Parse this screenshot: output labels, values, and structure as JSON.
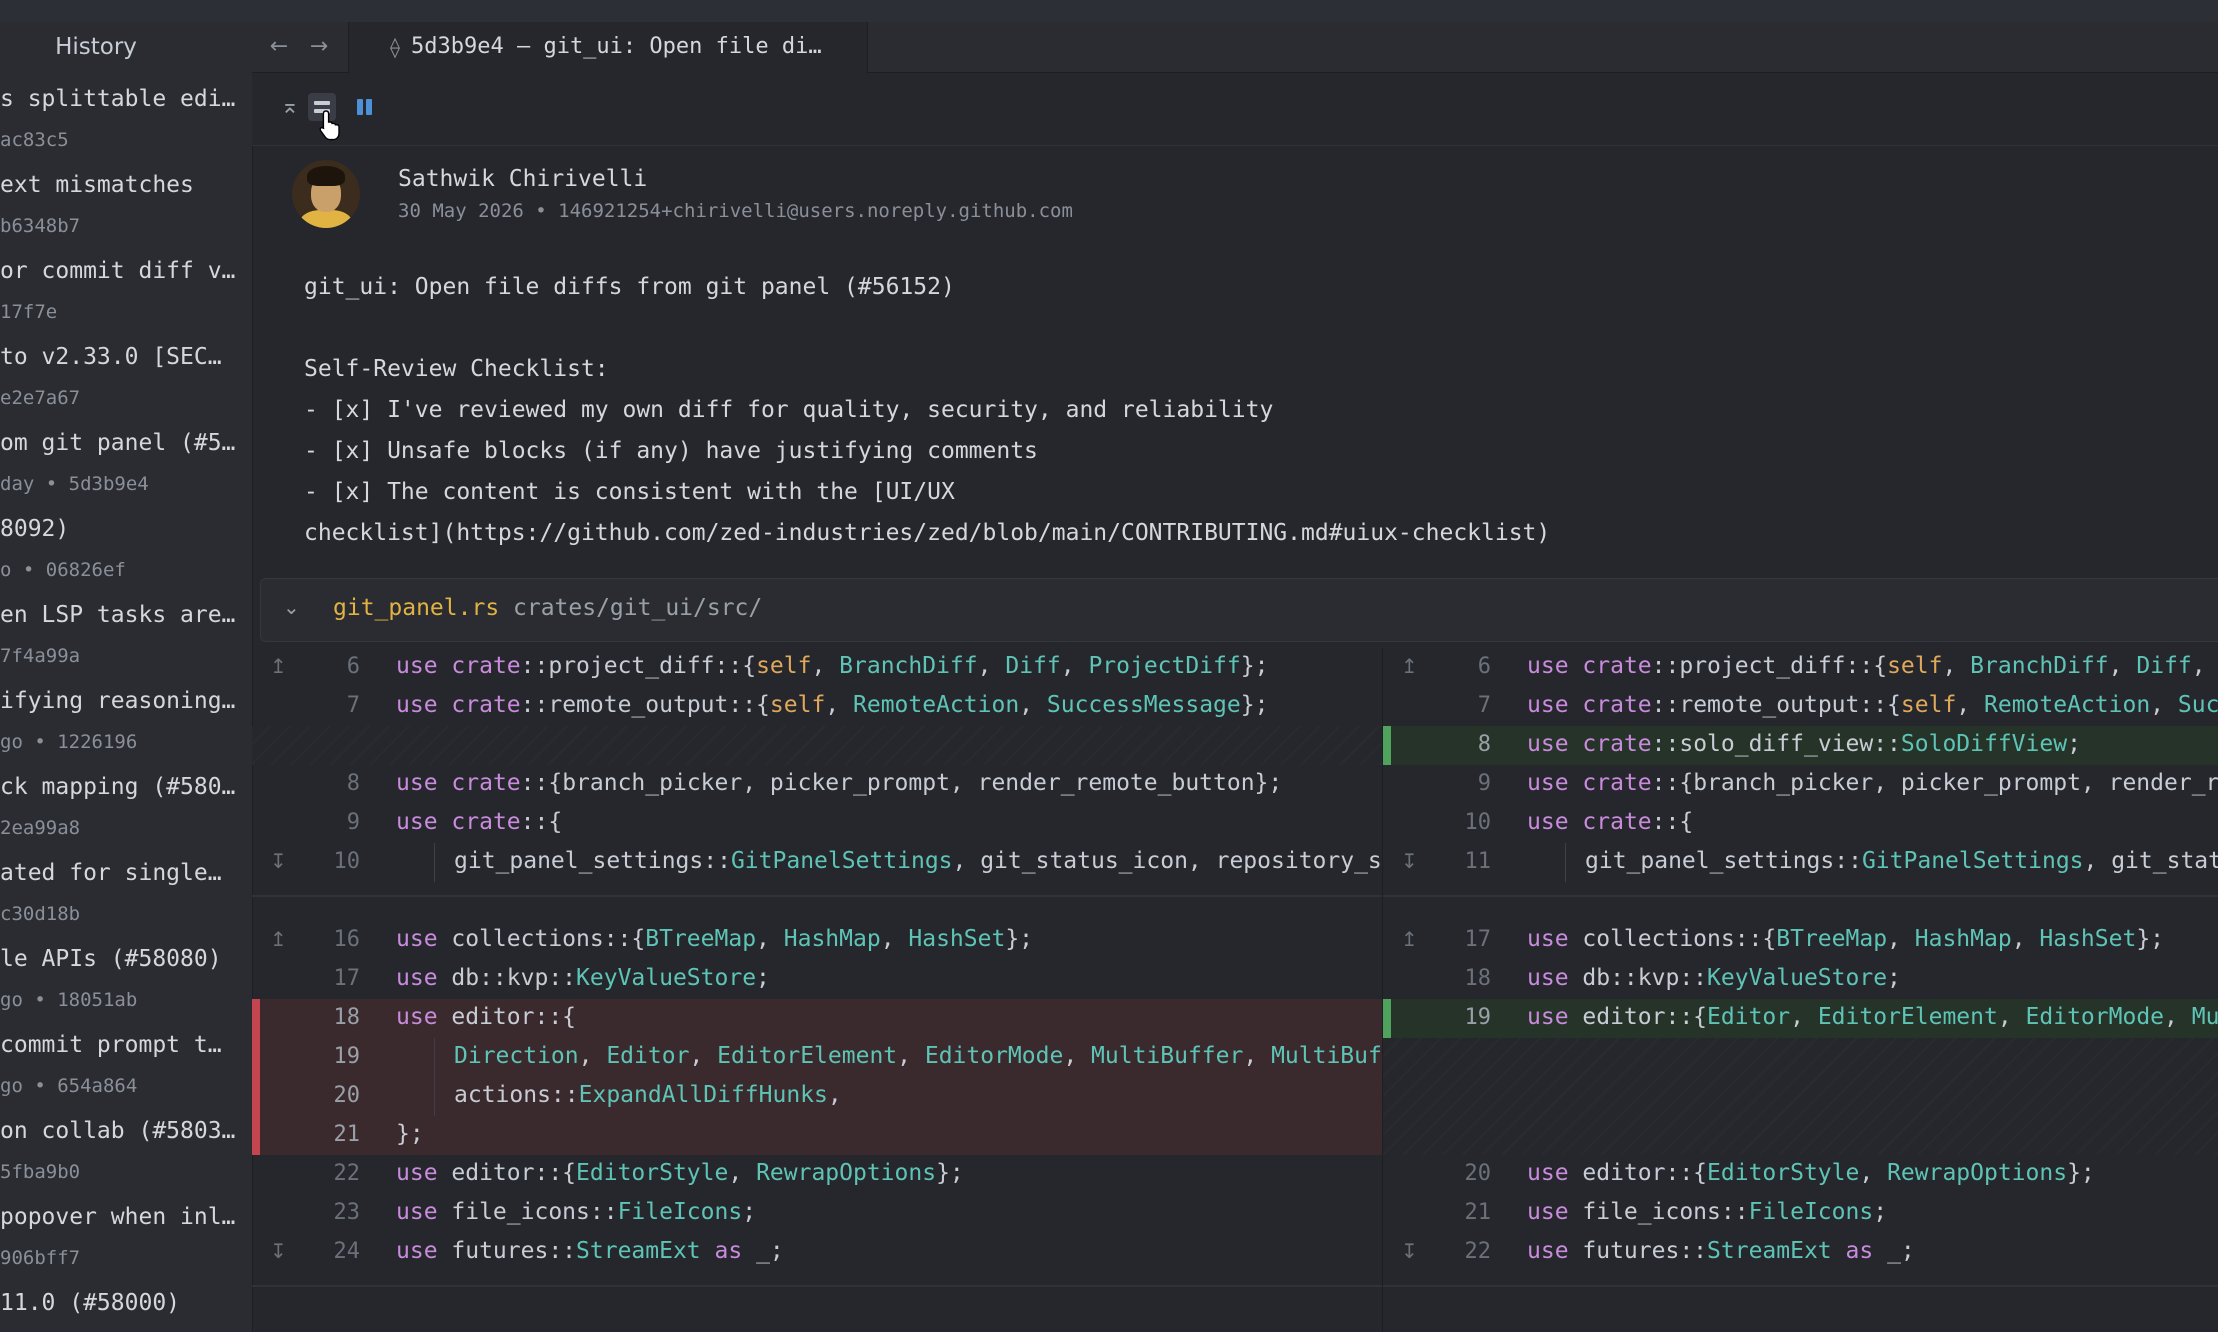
{
  "history": {
    "title": "History",
    "items": [
      {
        "subject": "s splittable edi…",
        "meta": "ac83c5"
      },
      {
        "subject": "ext mismatches",
        "meta": "b6348b7"
      },
      {
        "subject": "or commit diff v…",
        "meta": "17f7e"
      },
      {
        "subject": " to v2.33.0 [SEC…",
        "meta": " e2e7a67"
      },
      {
        "subject": "om git panel (#5…",
        "meta": "day • 5d3b9e4"
      },
      {
        "subject": "8092)",
        "meta": "o • 06826ef"
      },
      {
        "subject": "en LSP tasks are…",
        "meta": "7f4a99a"
      },
      {
        "subject": "ifying reasoning…",
        "meta": "go • 1226196"
      },
      {
        "subject": "ck mapping (#580…",
        "meta": " 2ea99a8"
      },
      {
        "subject": "ated for single…",
        "meta": "c30d18b"
      },
      {
        "subject": "le APIs (#58080)",
        "meta": "go • 18051ab"
      },
      {
        "subject": " commit prompt t…",
        "meta": "go • 654a864"
      },
      {
        "subject": "on collab (#5803…",
        "meta": " 5fba9b0"
      },
      {
        "subject": "popover when inl…",
        "meta": " 906bff7"
      },
      {
        "subject": "11.0 (#58000)",
        "meta": ""
      }
    ]
  },
  "tab": {
    "label": "5d3b9e4 — git_ui: Open file di…"
  },
  "commit": {
    "author": "Sathwik Chirivelli",
    "meta": "30 May 2026 • 146921254+chirivelli@users.noreply.github.com",
    "message": [
      "git_ui: Open file diffs from git panel (#56152)",
      "",
      "Self-Review Checklist:",
      "- [x] I've reviewed my own diff for quality, security, and reliability",
      "- [x] Unsafe blocks (if any) have justifying comments",
      "- [x] The content is consistent with the [UI/UX",
      "checklist](https://github.com/zed-industries/zed/blob/main/CONTRIBUTING.md#uiux-checklist)"
    ]
  },
  "file": {
    "name": "git_panel.rs",
    "path": "crates/git_ui/src/"
  },
  "colors": {
    "keyword": "#c98bdc",
    "type": "#5ec4b6",
    "self": "#e0a85a",
    "deleted_bar": "#c2454f",
    "added_bar": "#4fa35c"
  },
  "diff": {
    "left": [
      {
        "n": "6",
        "code": "use crate::project_diff::{self, BranchDiff, Diff, ProjectDiff};"
      },
      {
        "n": "7",
        "code": "use crate::remote_output::{self, RemoteAction, SuccessMessage};"
      },
      {
        "n": "8",
        "code": "use crate::{branch_picker, picker_prompt, render_remote_button};"
      },
      {
        "n": "9",
        "code": "use crate::{"
      },
      {
        "n": "10",
        "code": "git_panel_settings::GitPanelSettings, git_status_icon, repository_selector::RepositorySelector,"
      },
      {
        "n": "16",
        "code": "use collections::{BTreeMap, HashMap, HashSet};"
      },
      {
        "n": "17",
        "code": "use db::kvp::KeyValueStore;"
      },
      {
        "n": "18",
        "code": "use editor::{"
      },
      {
        "n": "19",
        "code": "Direction, Editor, EditorElement, EditorMode, MultiBuffer, MultiBufferOffset,"
      },
      {
        "n": "20",
        "code": "actions::ExpandAllDiffHunks,"
      },
      {
        "n": "21",
        "code": "};"
      },
      {
        "n": "22",
        "code": "use editor::{EditorStyle, RewrapOptions};"
      },
      {
        "n": "23",
        "code": "use file_icons::FileIcons;"
      },
      {
        "n": "24",
        "code": "use futures::StreamExt as _;"
      }
    ],
    "right": [
      {
        "n": "6",
        "code": "use crate::project_diff::{self, BranchDiff, Diff, ProjectDiff};"
      },
      {
        "n": "7",
        "code": "use crate::remote_output::{self, RemoteAction, SuccessMessage};"
      },
      {
        "n": "8",
        "code": "use crate::solo_diff_view::SoloDiffView;"
      },
      {
        "n": "9",
        "code": "use crate::{branch_picker, picker_prompt, render_remote_button};"
      },
      {
        "n": "10",
        "code": "use crate::{"
      },
      {
        "n": "11",
        "code": "git_panel_settings::GitPanelSettings, git_status_icon, repository_selector::RepositorySelector,"
      },
      {
        "n": "17",
        "code": "use collections::{BTreeMap, HashMap, HashSet};"
      },
      {
        "n": "18",
        "code": "use db::kvp::KeyValueStore;"
      },
      {
        "n": "19",
        "code": "use editor::{Editor, EditorElement, EditorMode, MultiBuffer, MultiBufferOffset};"
      },
      {
        "n": "20",
        "code": "use editor::{EditorStyle, RewrapOptions};"
      },
      {
        "n": "21",
        "code": "use file_icons::FileIcons;"
      },
      {
        "n": "22",
        "code": "use futures::StreamExt as _;"
      }
    ]
  }
}
